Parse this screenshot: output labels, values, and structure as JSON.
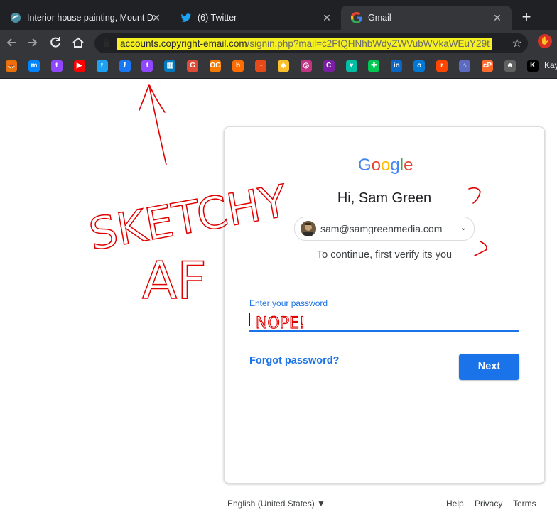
{
  "tabs": [
    {
      "title": "Interior house painting, Mount D",
      "icon": "site-favicon-icon"
    },
    {
      "title": "(6) Twitter",
      "icon": "twitter-icon"
    },
    {
      "title": "Gmail",
      "icon": "google-icon"
    }
  ],
  "toolbar": {
    "url_host": "accounts.copyright-email.com",
    "url_path": "/signin.php?mail=c2FtQHNhbWdyZWVubWVkaWEuY29t"
  },
  "bookmarks": {
    "items": [
      {
        "icon": "fox-icon",
        "color": "#e8710a",
        "glyph": "🦊"
      },
      {
        "icon": "messenger-icon",
        "color": "#0084ff",
        "glyph": "m"
      },
      {
        "icon": "twitch-icon",
        "color": "#9146ff",
        "glyph": "t"
      },
      {
        "icon": "youtube-icon",
        "color": "#ff0000",
        "glyph": "▶"
      },
      {
        "icon": "twitter-icon",
        "color": "#1da1f2",
        "glyph": "t"
      },
      {
        "icon": "facebook-icon",
        "color": "#1877f2",
        "glyph": "f"
      },
      {
        "icon": "twitch-icon",
        "color": "#9146ff",
        "glyph": "t"
      },
      {
        "icon": "trello-icon",
        "color": "#0079bf",
        "glyph": "▥"
      },
      {
        "icon": "google-plus-icon",
        "color": "#dd4b39",
        "glyph": "G"
      },
      {
        "icon": "og-icon",
        "color": "#f57c00",
        "glyph": "OG"
      },
      {
        "icon": "b-icon",
        "color": "#ff6d00",
        "glyph": "b"
      },
      {
        "icon": "chart-icon",
        "color": "#e64a19",
        "glyph": "~"
      },
      {
        "icon": "diamond-icon",
        "color": "#fbc02d",
        "glyph": "◆"
      },
      {
        "icon": "instagram-icon",
        "color": "#c13584",
        "glyph": "◎"
      },
      {
        "icon": "c-icon",
        "color": "#7b1fa2",
        "glyph": "C"
      },
      {
        "icon": "heart-icon",
        "color": "#00bfa5",
        "glyph": "♥"
      },
      {
        "icon": "puzzle-icon",
        "color": "#00c853",
        "glyph": "✚"
      },
      {
        "icon": "linkedin-icon",
        "color": "#0a66c2",
        "glyph": "in"
      },
      {
        "icon": "outlook-icon",
        "color": "#0078d4",
        "glyph": "o"
      },
      {
        "icon": "reddit-icon",
        "color": "#ff4500",
        "glyph": "r"
      },
      {
        "icon": "house-icon",
        "color": "#5c6bc0",
        "glyph": "⌂"
      },
      {
        "icon": "cpanel-icon",
        "color": "#ff6c2c",
        "glyph": "cP"
      },
      {
        "icon": "skull-icon",
        "color": "#616161",
        "glyph": "☻"
      },
      {
        "icon": "k-icon",
        "color": "#000000",
        "glyph": "K"
      }
    ],
    "last_label": "Kay"
  },
  "card": {
    "logo": "Google",
    "greeting": "Hi, Sam Green",
    "email": "sam@samgreenmedia.com",
    "subtitle": "To continue, first verify its you",
    "password_label": "Enter your password",
    "forgot_label": "Forgot password?",
    "next_label": "Next"
  },
  "footer": {
    "language": "English (United States) ▼",
    "help": "Help",
    "privacy": "Privacy",
    "terms": "Terms"
  },
  "annotations": {
    "sketchy": "SKETCHY",
    "af": "AF",
    "nope": "NOPE!",
    "question": "?",
    "color": "#e00000"
  },
  "colors": {
    "accent": "#1a73e8",
    "url_highlight": "#f5f020"
  }
}
